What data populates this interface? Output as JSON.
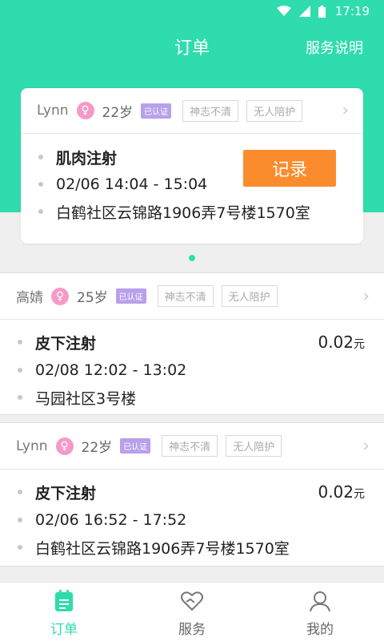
{
  "status_bar": {
    "time": "17:19"
  },
  "header": {
    "title": "订单",
    "help_link": "服务说明"
  },
  "featured_order": {
    "user": {
      "name": "Lynn",
      "gender_symbol": "♀",
      "age": "22岁",
      "verified": "已认证",
      "tags": [
        "神志不清",
        "无人陪护"
      ]
    },
    "service": "肌肉注射",
    "time": "02/06 14:04 - 15:04",
    "address": "白鹤社区云锦路1906弄7号楼1570室",
    "action_label": "记录"
  },
  "orders": [
    {
      "user": {
        "name": "高婧",
        "gender_symbol": "♀",
        "age": "25岁",
        "verified": "已认证",
        "tags": [
          "神志不清",
          "无人陪护"
        ]
      },
      "service": "皮下注射",
      "price": "0.02",
      "unit": "元",
      "time": "02/08 12:02 - 13:02",
      "address": "马园社区3号楼"
    },
    {
      "user": {
        "name": "Lynn",
        "gender_symbol": "♀",
        "age": "22岁",
        "verified": "已认证",
        "tags": [
          "神志不清",
          "无人陪护"
        ]
      },
      "service": "皮下注射",
      "price": "0.02",
      "unit": "元",
      "time": "02/06 16:52 - 17:52",
      "address": "白鹤社区云锦路1906弄7号楼1570室"
    }
  ],
  "bottom_nav": [
    {
      "label": "订单",
      "icon": "clipboard-icon",
      "active": true
    },
    {
      "label": "服务",
      "icon": "heart-hand-icon",
      "active": false
    },
    {
      "label": "我的",
      "icon": "person-icon",
      "active": false
    }
  ],
  "colors": {
    "primary": "#2fdcad",
    "action": "#fb8c2e",
    "verified_badge": "#b8a0ea",
    "gender_female": "#f59ac6"
  }
}
